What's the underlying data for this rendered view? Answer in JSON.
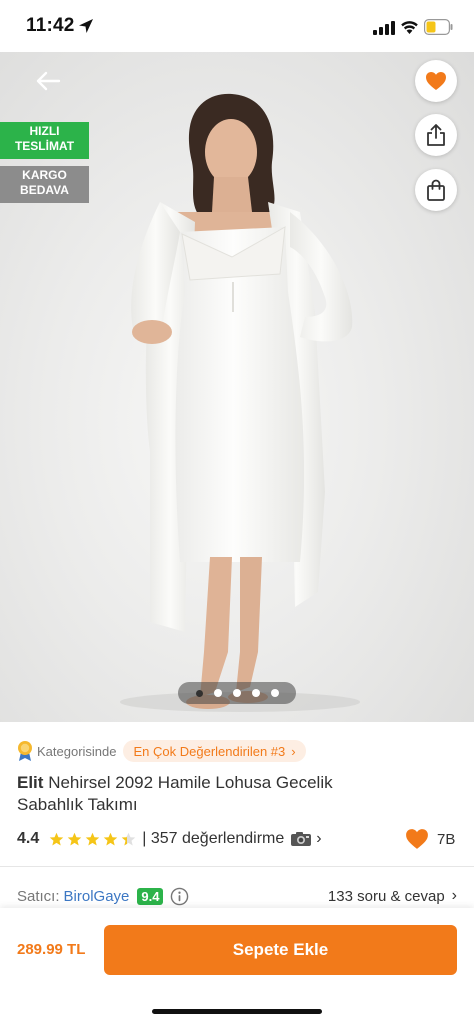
{
  "status_bar": {
    "time": "11:42",
    "icons": [
      "location-arrow-icon",
      "cellular-signal-icon",
      "wifi-icon",
      "battery-icon"
    ],
    "battery_color": "#f5c518"
  },
  "hero": {
    "badges": {
      "fast_delivery": "HIZLI TESLİMAT",
      "free_shipping": "KARGO BEDAVA"
    },
    "badge_colors": {
      "fast_delivery": "#2cb34a",
      "free_shipping": "#8c8c8c"
    },
    "image_count": 5,
    "active_image": 1,
    "icons": [
      "back-arrow-icon",
      "heart-icon",
      "share-icon",
      "shopping-bag-icon"
    ]
  },
  "product": {
    "category_prefix": "Kategorisinde",
    "category_badge": "En Çok Değerlendirilen #3",
    "brand": "Elit",
    "name": "Nehirsel 2092 Hamile Lohusa Gecelik Sabahlık Takımı",
    "rating": "4.4",
    "rating_value": 4.4,
    "review_text": "| 357 değerlendirme",
    "like_count": "7B",
    "seller_label": "Satıcı:",
    "seller_name": "BirolGaye",
    "seller_score": "9.4",
    "qa_text": "133 soru & cevap"
  },
  "purchase": {
    "price": "289.99 TL",
    "add_to_cart": "Sepete Ekle"
  },
  "colors": {
    "accent": "#f27a1a",
    "accent_light": "#fdeee3",
    "seller_link": "#3c77c3",
    "success": "#2cb34a"
  }
}
